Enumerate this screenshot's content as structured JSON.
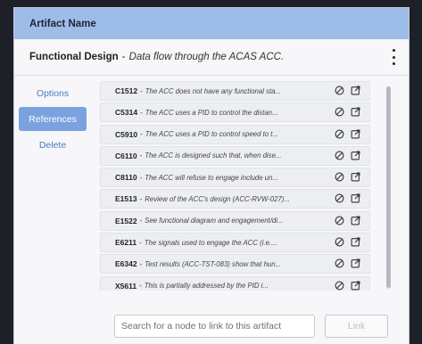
{
  "header": {
    "title": "Artifact Name"
  },
  "artifact": {
    "name": "Functional Design",
    "separator": "-",
    "description": "Data flow through the ACAS ACC."
  },
  "sidebar": {
    "items": [
      {
        "label": "Options"
      },
      {
        "label": "References"
      },
      {
        "label": "Delete"
      }
    ]
  },
  "references": [
    {
      "code": "C1512",
      "text": "The ACC does not have any functional sta..."
    },
    {
      "code": "C5314",
      "text": "The ACC uses a PID to control the distan..."
    },
    {
      "code": "C5910",
      "text": "The ACC uses a PID to control speed to t..."
    },
    {
      "code": "C6110",
      "text": "The ACC is designed such that, when dise..."
    },
    {
      "code": "C8110",
      "text": "The ACC will refuse to engage include un..."
    },
    {
      "code": "E1513",
      "text": "Review of the ACC's design (ACC-RVW-027)..."
    },
    {
      "code": "E1522",
      "text": "See functional diagram and engagement/di..."
    },
    {
      "code": "E6211",
      "text": "The signals used to engage the ACC (i.e...."
    },
    {
      "code": "E6342",
      "text": "Test results (ACC-TST-083) show that hun..."
    },
    {
      "code": "X5611",
      "text": "This is partially addressed by the PID i..."
    }
  ],
  "search": {
    "placeholder": "Search for a node to link to this artifact",
    "value": ""
  },
  "link_button": {
    "label": "Link",
    "state": "disabled"
  },
  "icons": {
    "unlink": "block-icon",
    "open": "external-link-icon",
    "menu": "kebab-menu-icon"
  },
  "colors": {
    "header_bg": "#9dbde8",
    "active_tab_bg": "#7aa2e0",
    "link_text": "#4a79c2"
  }
}
